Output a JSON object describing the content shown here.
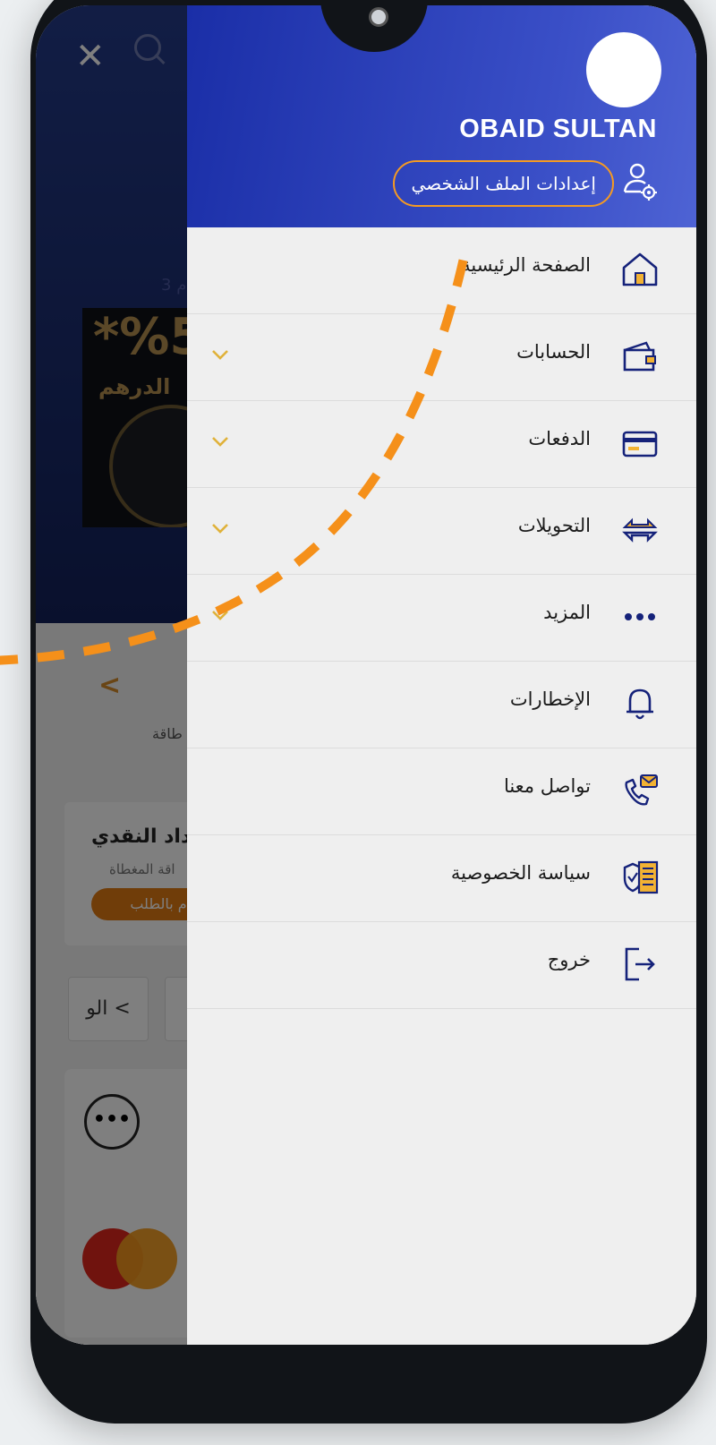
{
  "app": {
    "close_glyph": "✕",
    "background_note_text": "3 م",
    "promo_percent": "*%5",
    "promo_text": "الدرهم",
    "breadcrumb_glyph": "<",
    "tab_label": "طاقة",
    "cashback_card": {
      "title": "رداد النقدي",
      "subtitle": "اقة المغطاة",
      "button": "م بالطلب"
    },
    "pill_label": "الو <",
    "more_glyph": "•••"
  },
  "drawer": {
    "user_name": "OBAID SULTAN",
    "profile_settings_label": "إعدادات الملف الشخصي",
    "menu": [
      {
        "label": "الصفحة الرئيسية",
        "icon": "home-icon",
        "has_submenu": false
      },
      {
        "label": "الحسابات",
        "icon": "wallet-icon",
        "has_submenu": true
      },
      {
        "label": "الدفعات",
        "icon": "card-icon",
        "has_submenu": true
      },
      {
        "label": "التحويلات",
        "icon": "transfer-arrows-icon",
        "has_submenu": true
      },
      {
        "label": "المزيد",
        "icon": "more-dots-icon",
        "has_submenu": true
      },
      {
        "label": "الإخطارات",
        "icon": "bell-icon",
        "has_submenu": false
      },
      {
        "label": "تواصل معنا",
        "icon": "contact-phone-icon",
        "has_submenu": false
      },
      {
        "label": "سياسة الخصوصية",
        "icon": "privacy-shield-icon",
        "has_submenu": false
      },
      {
        "label": "خروج",
        "icon": "logout-icon",
        "has_submenu": false
      }
    ]
  },
  "colors": {
    "drawer_header": "#2a3fba",
    "accent_orange": "#f59a22",
    "chevron_gold": "#e0b23a",
    "icon_navy": "#15227a"
  }
}
